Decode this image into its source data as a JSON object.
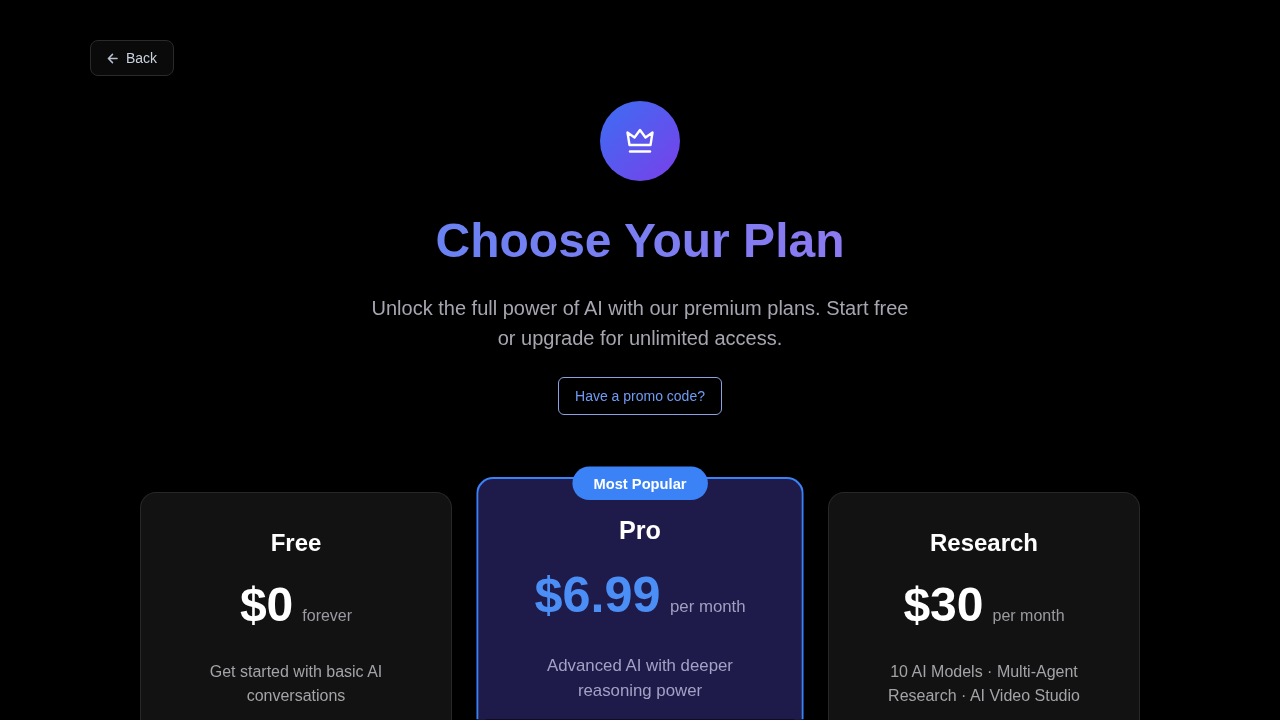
{
  "back_button": {
    "label": "Back"
  },
  "header": {
    "title": "Choose Your Plan",
    "subtitle": "Unlock the full power of AI with our premium plans. Start free or upgrade for unlimited access.",
    "promo_button": {
      "label": "Have a promo code?"
    }
  },
  "plans": [
    {
      "name": "Free",
      "price": "$0",
      "period": "forever",
      "description": "Get started with basic AI conversations",
      "highlighted": false
    },
    {
      "name": "Pro",
      "badge": "Most Popular",
      "price": "$6.99",
      "period": "per month",
      "description": "Advanced AI with deeper reasoning power",
      "highlighted": true
    },
    {
      "name": "Research",
      "price": "$30",
      "period": "per month",
      "description": "10 AI Models · Multi-Agent Research · AI Video Studio",
      "highlighted": false
    }
  ]
}
